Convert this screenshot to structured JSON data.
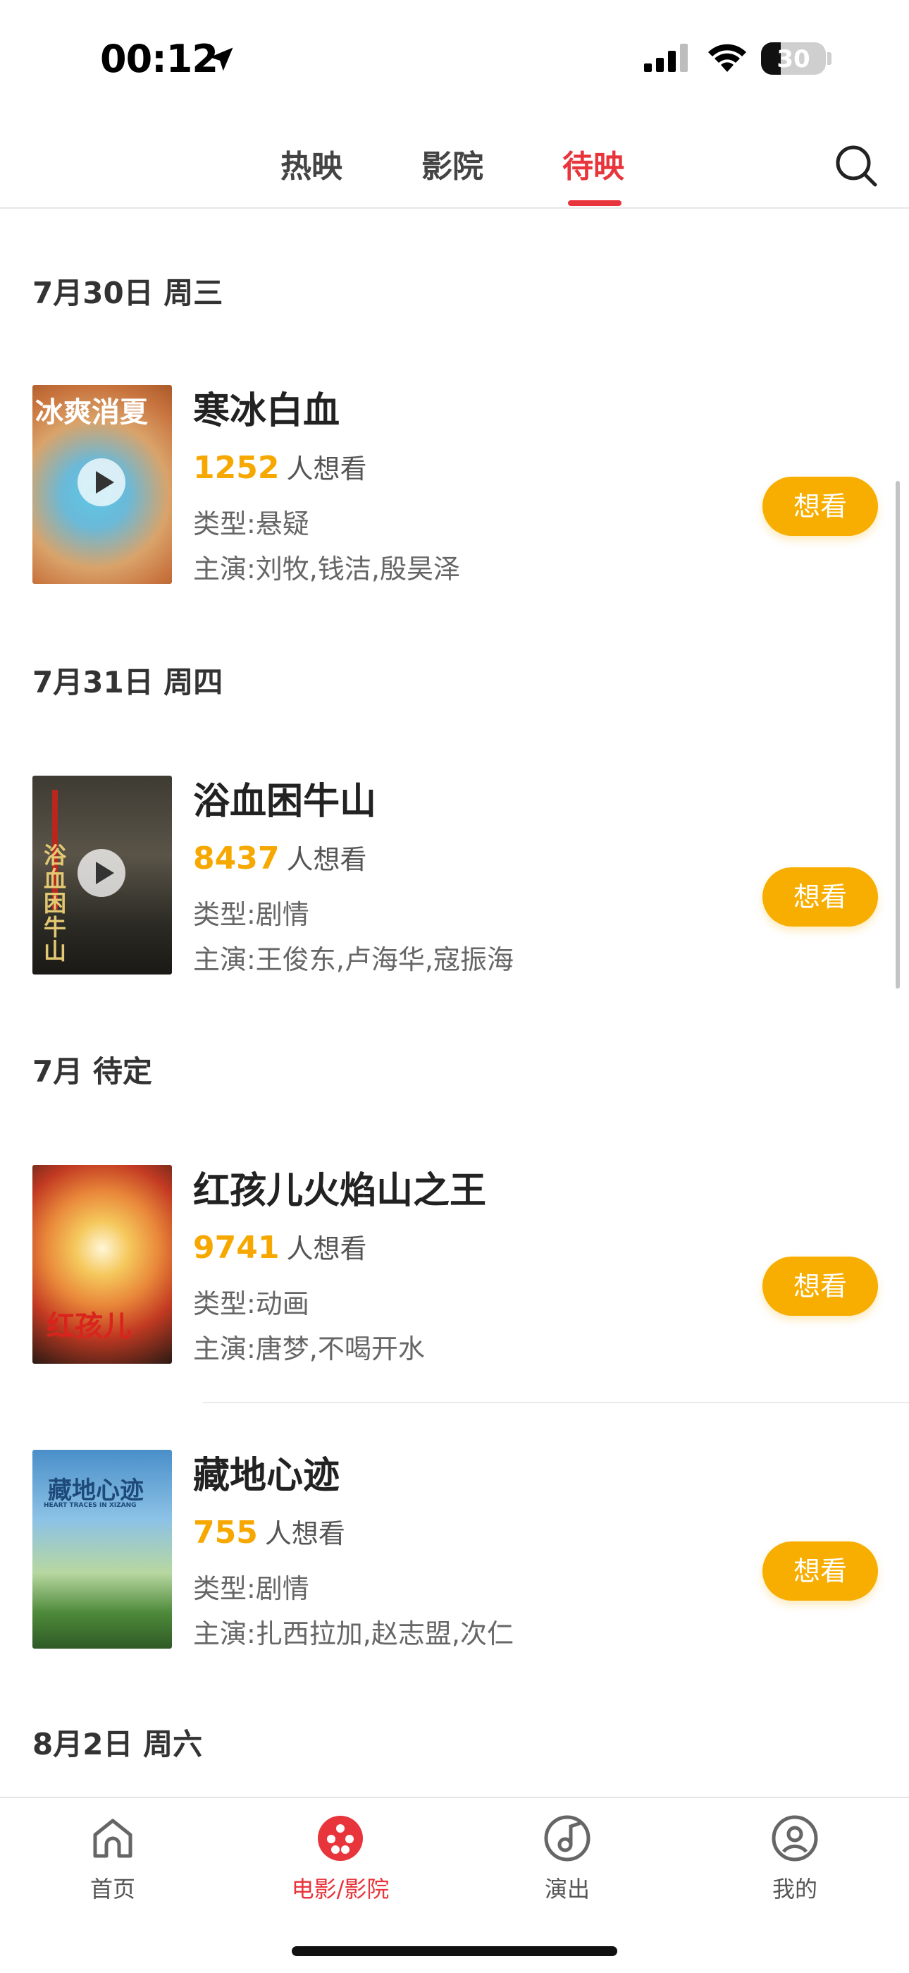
{
  "status_bar": {
    "time": "00:12",
    "battery": "30"
  },
  "tabs": [
    {
      "label": "热映",
      "active": false
    },
    {
      "label": "影院",
      "active": false
    },
    {
      "label": "待映",
      "active": true
    }
  ],
  "sections": [
    {
      "date": "7月30日 周三"
    },
    {
      "date": "7月31日 周四"
    },
    {
      "date": "7月 待定"
    },
    {
      "date": "8月2日 周六"
    }
  ],
  "movies": [
    {
      "title": "寒冰白血",
      "want_count": "1252",
      "want_suffix": "人想看",
      "genre": "类型:悬疑",
      "cast": "主演:刘牧,钱洁,殷昊泽",
      "poster_text": "冰爽消夏",
      "has_trailer": true
    },
    {
      "title": "浴血困牛山",
      "want_count": "8437",
      "want_suffix": "人想看",
      "genre": "类型:剧情",
      "cast": "主演:王俊东,卢海华,寇振海",
      "poster_text": "浴血困牛山",
      "has_trailer": true
    },
    {
      "title": "红孩儿火焰山之王",
      "want_count": "9741",
      "want_suffix": "人想看",
      "genre": "类型:动画",
      "cast": "主演:唐梦,不喝开水",
      "poster_text": "红孩儿",
      "has_trailer": false
    },
    {
      "title": "藏地心迹",
      "want_count": "755",
      "want_suffix": "人想看",
      "genre": "类型:剧情",
      "cast": "主演:扎西拉加,赵志盟,次仁",
      "poster_text": "藏地心迹",
      "poster_subtext": "HEART TRACES IN XIZANG",
      "has_trailer": false
    }
  ],
  "want_button_label": "想看",
  "bottom_nav": [
    {
      "label": "首页",
      "icon": "home-icon",
      "active": false
    },
    {
      "label": "电影/影院",
      "icon": "film-reel-icon",
      "active": true
    },
    {
      "label": "演出",
      "icon": "music-note-icon",
      "active": false
    },
    {
      "label": "我的",
      "icon": "profile-icon",
      "active": false
    }
  ],
  "colors": {
    "accent": "#e8353c",
    "want_count": "#f6a800",
    "want_button": "#f8ae00"
  }
}
